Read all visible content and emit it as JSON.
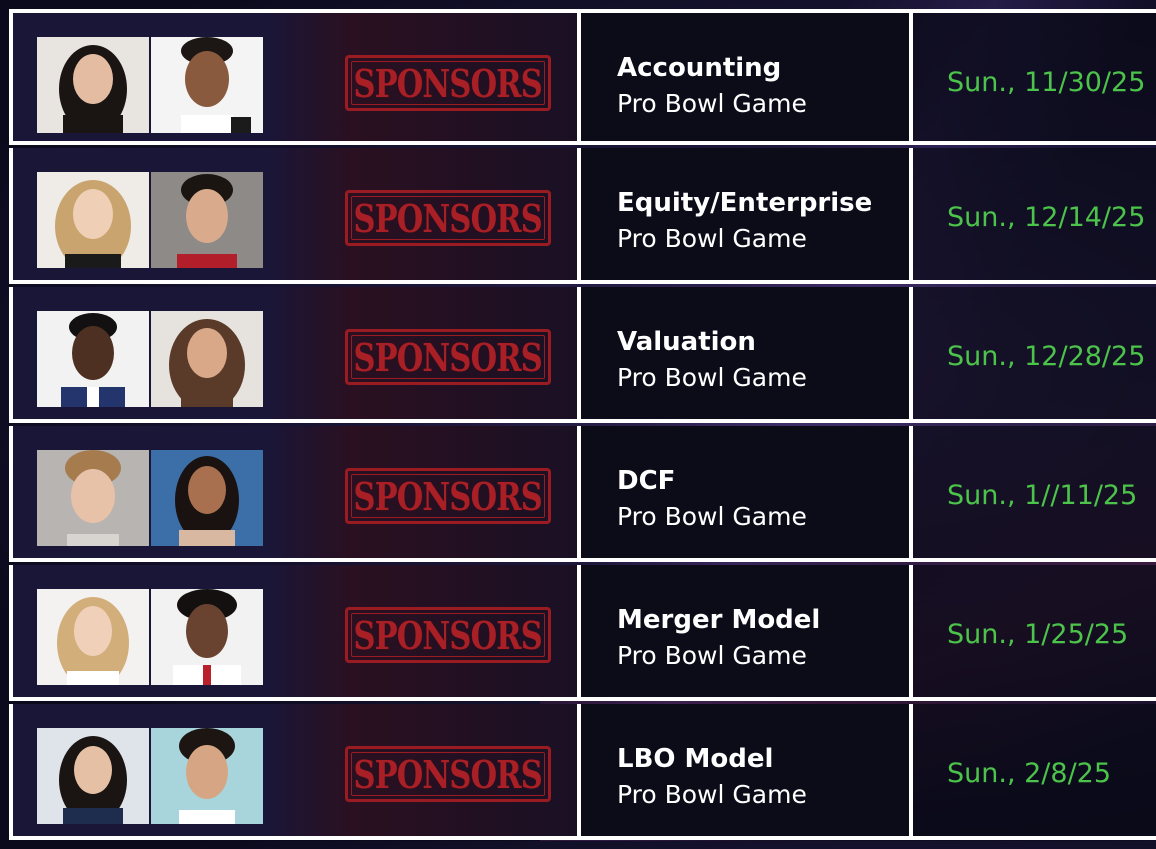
{
  "stamp_label": "SPONSORS",
  "rows": [
    {
      "title": "Accounting",
      "subtitle": "Pro Bowl Game",
      "date": "Sun., 11/30/25"
    },
    {
      "title": "Equity/Enterprise",
      "subtitle": "Pro Bowl Game",
      "date": "Sun., 12/14/25"
    },
    {
      "title": "Valuation",
      "subtitle": "Pro Bowl Game",
      "date": "Sun., 12/28/25"
    },
    {
      "title": "DCF",
      "subtitle": "Pro Bowl Game",
      "date": "Sun., 1//11/25"
    },
    {
      "title": "Merger Model",
      "subtitle": "Pro Bowl Game",
      "date": "Sun., 1/25/25"
    },
    {
      "title": "LBO Model",
      "subtitle": "Pro Bowl Game",
      "date": "Sun., 2/8/25"
    }
  ],
  "colors": {
    "date_green": "#4cc34a",
    "stamp_red": "#a81f26",
    "border": "#ffffff"
  }
}
